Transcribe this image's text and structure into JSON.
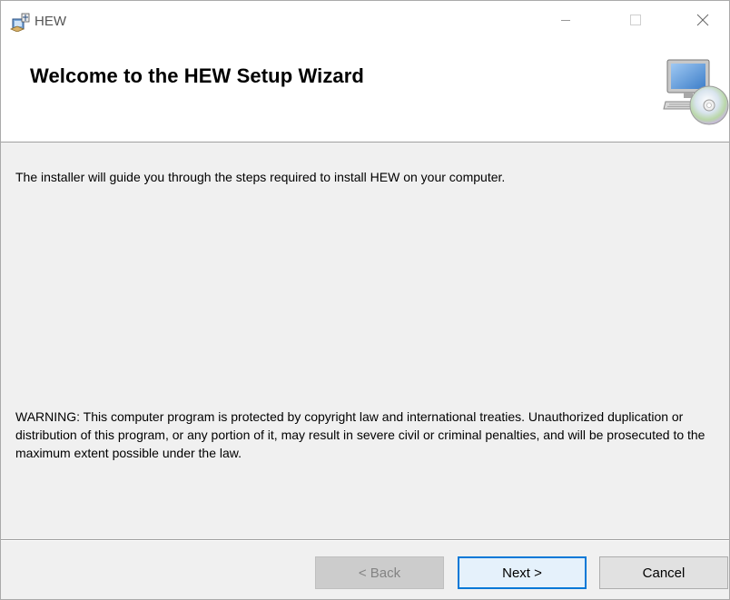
{
  "window": {
    "title": "HEW"
  },
  "banner": {
    "title": "Welcome to the HEW Setup Wizard"
  },
  "body": {
    "intro": "The installer will guide you through the steps required to install HEW on your computer.",
    "warning": "WARNING: This computer program is protected by copyright law and international treaties. Unauthorized duplication or distribution of this program, or any portion of it, may result in severe civil or criminal penalties, and will be prosecuted to the maximum extent possible under the law."
  },
  "buttons": {
    "back": "< Back",
    "next": "Next >",
    "cancel": "Cancel"
  },
  "icons": {
    "app": "installer-package-icon",
    "banner": "computer-cd-icon",
    "minimize": "minimize-icon",
    "maximize": "maximize-icon",
    "close": "close-icon"
  },
  "colors": {
    "focus_accent": "#0078d7",
    "window_bg": "#f0f0f0",
    "banner_bg": "#ffffff"
  }
}
